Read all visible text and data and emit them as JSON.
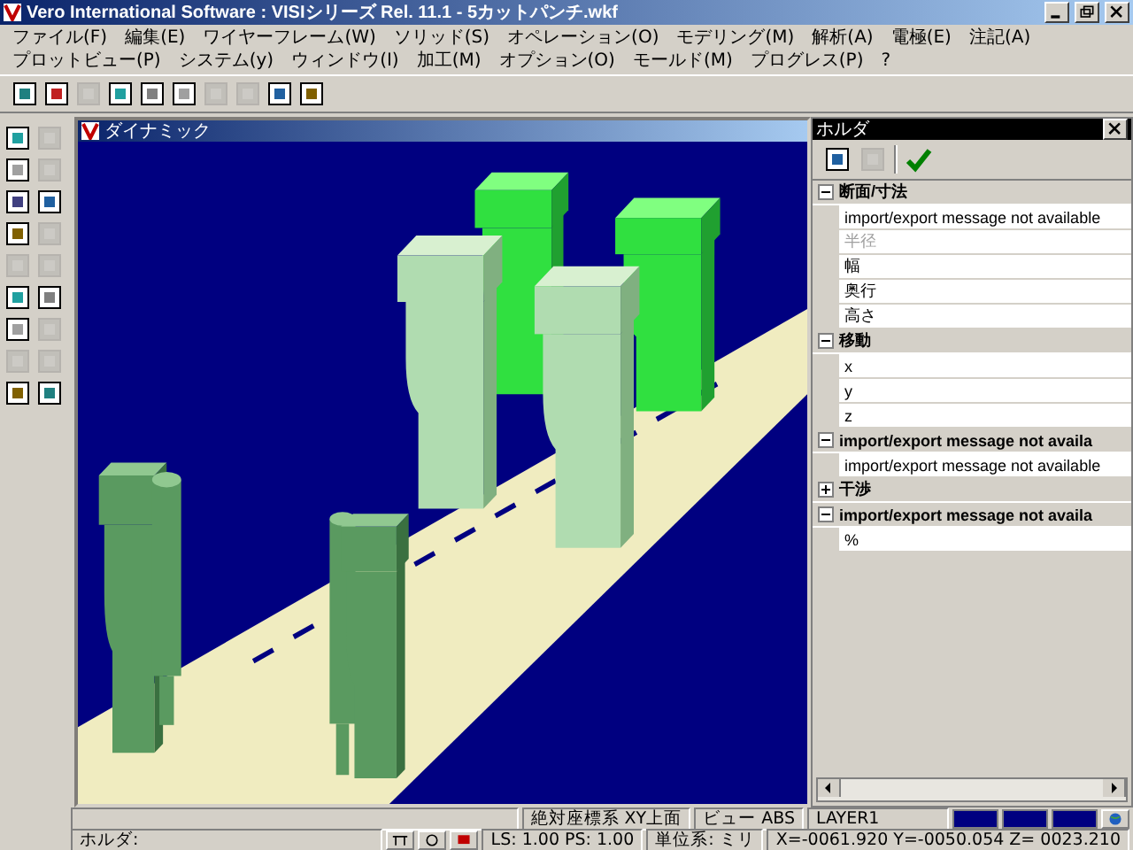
{
  "window": {
    "title": "Vero International Software : VISIシリーズ Rel. 11.1 - 5カットパンチ.wkf"
  },
  "menu": [
    "ファイル(F)",
    "編集(E)",
    "ワイヤーフレーム(W)",
    "ソリッド(S)",
    "オペレーション(O)",
    "モデリング(M)",
    "解析(A)",
    "電極(E)",
    "注記(A)",
    "プロットビュー(P)",
    "システム(y)",
    "ウィンドウ(I)",
    "加工(M)",
    "オプション(O)",
    "モールド(M)",
    "プログレス(P)",
    "?"
  ],
  "toolbar": [
    {
      "disabled": false
    },
    {
      "disabled": false
    },
    {
      "disabled": true
    },
    {
      "disabled": false
    },
    {
      "disabled": false
    },
    {
      "disabled": false
    },
    {
      "disabled": true
    },
    {
      "disabled": true
    },
    {
      "disabled": false
    },
    {
      "disabled": false
    }
  ],
  "toolbox": [
    {
      "disabled": false
    },
    {
      "disabled": true
    },
    {
      "disabled": false
    },
    {
      "disabled": true
    },
    {
      "disabled": false
    },
    {
      "disabled": false
    },
    {
      "disabled": false
    },
    {
      "disabled": true
    },
    {
      "disabled": true
    },
    {
      "disabled": true
    },
    {
      "disabled": false
    },
    {
      "disabled": false
    },
    {
      "disabled": false
    },
    {
      "disabled": true
    },
    {
      "disabled": true
    },
    {
      "disabled": true
    },
    {
      "disabled": false
    },
    {
      "disabled": false
    }
  ],
  "viewport": {
    "title": "ダイナミック"
  },
  "panel": {
    "title": "ホルダ",
    "tools": [
      {
        "disabled": false
      },
      {
        "disabled": true
      },
      {
        "disabled": false
      }
    ],
    "sections": [
      {
        "label": "断面/寸法",
        "expanded": true,
        "children": [
          {
            "label": "import/export message not available",
            "disabled": false
          },
          {
            "label": "半径",
            "disabled": true
          },
          {
            "label": "幅",
            "disabled": false
          },
          {
            "label": "奥行",
            "disabled": false
          },
          {
            "label": "高さ",
            "disabled": false
          }
        ]
      },
      {
        "label": "移動",
        "expanded": true,
        "children": [
          {
            "label": "x",
            "disabled": false
          },
          {
            "label": "y",
            "disabled": false
          },
          {
            "label": "z",
            "disabled": false
          }
        ]
      },
      {
        "label": "import/export message not availa",
        "expanded": true,
        "children": [
          {
            "label": "import/export message not available",
            "disabled": false
          }
        ]
      },
      {
        "label": "干渉",
        "expanded": false
      },
      {
        "label": "import/export message not availa",
        "expanded": true,
        "children": [
          {
            "label": "%",
            "disabled": false
          }
        ]
      }
    ]
  },
  "status_bar": {
    "coordinate_system": "絶対座標系 XY上面",
    "view": "ビュー ABS",
    "layer": "LAYER1",
    "prompt": "ホルダ:",
    "scale": "LS: 1.00 PS: 1.00",
    "units": "単位系: ミリ",
    "coordinates": "X=-0061.920 Y=-0050.054 Z= 0023.210"
  }
}
